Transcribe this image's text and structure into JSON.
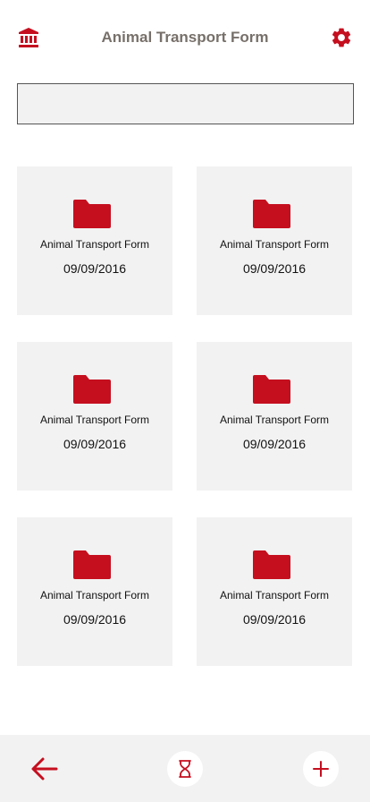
{
  "header": {
    "title": "Animal Transport Form",
    "left_icon": "bank-icon",
    "right_icon": "gear-icon"
  },
  "search": {
    "value": "",
    "placeholder": ""
  },
  "cards": [
    {
      "title": "Animal Transport Form",
      "date": "09/09/2016",
      "icon": "folder-icon"
    },
    {
      "title": "Animal Transport Form",
      "date": "09/09/2016",
      "icon": "folder-icon"
    },
    {
      "title": "Animal Transport Form",
      "date": "09/09/2016",
      "icon": "folder-icon"
    },
    {
      "title": "Animal Transport Form",
      "date": "09/09/2016",
      "icon": "folder-icon"
    },
    {
      "title": "Animal Transport Form",
      "date": "09/09/2016",
      "icon": "folder-icon"
    },
    {
      "title": "Animal Transport Form",
      "date": "09/09/2016",
      "icon": "folder-icon"
    }
  ],
  "bottom_bar": {
    "left_icon": "arrow-left-icon",
    "center_icon": "hourglass-icon",
    "right_icon": "plus-icon"
  },
  "colors": {
    "accent": "#c50f1f",
    "title_text": "#77706a",
    "card_background": "#f2f2f2"
  }
}
